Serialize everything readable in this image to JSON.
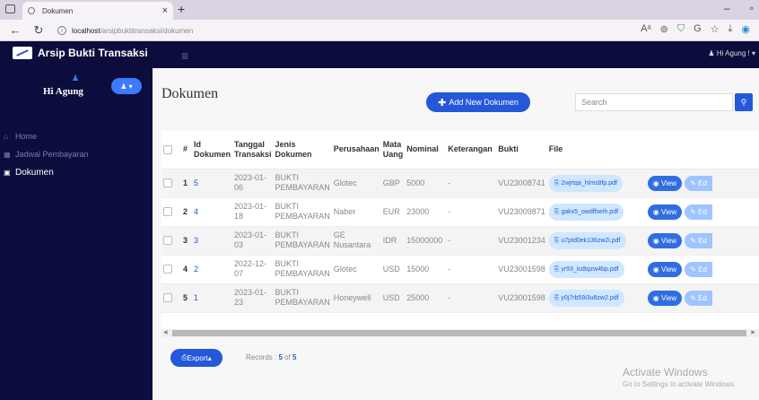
{
  "browser": {
    "tab_title": "Dokumen",
    "url_host": "localhost",
    "url_path": "/arsipbuktitransaksi/dokumen"
  },
  "app": {
    "brand": "Arsip Bukti Transaksi",
    "user_greeting": "Hi Agung !"
  },
  "sidebar": {
    "profile_name": "Hi Agung",
    "items": [
      {
        "label": "Home",
        "icon": "home-icon"
      },
      {
        "label": "Jadwal Pembayaran",
        "icon": "calendar-icon"
      },
      {
        "label": "Dokumen",
        "icon": "document-icon"
      }
    ],
    "active_index": 2
  },
  "main": {
    "title": "Dokumen",
    "add_button": "Add New Dokumen",
    "search_placeholder": "Search"
  },
  "table": {
    "headers": {
      "num": "#",
      "id": "Id Dokumen",
      "tanggal": "Tanggal Transaksi",
      "jenis": "Jenis Dokumen",
      "perusahaan": "Perusahaan",
      "mata_uang": "Mata Uang",
      "nominal": "Nominal",
      "keterangan": "Keterangan",
      "bukti": "Bukti",
      "file": "File"
    },
    "rows": [
      {
        "num": "1",
        "id": "5",
        "tanggal": "2023-01-06",
        "jenis": "BUKTI PEMBAYARAN",
        "perusahaan": "Glotec",
        "mata_uang": "GBP",
        "nominal": "5000",
        "keterangan": "-",
        "bukti": "VU23008741",
        "file": "2wjrtqa_hlms8fp.pdf"
      },
      {
        "num": "2",
        "id": "4",
        "tanggal": "2023-01-18",
        "jenis": "BUKTI PEMBAYARAN",
        "perusahaan": "Naber",
        "mata_uang": "EUR",
        "nominal": "23000",
        "keterangan": "-",
        "bukti": "VU23009871",
        "file": "gakx5_owdffseih.pdf"
      },
      {
        "num": "3",
        "id": "3",
        "tanggal": "2023-01-03",
        "jenis": "BUKTI PEMBAYARAN",
        "perusahaan": "GE Nusantara",
        "mata_uang": "IDR",
        "nominal": "15000000",
        "keterangan": "-",
        "bukti": "VU23001234",
        "file": "u7ptd0ek136zw2i.pdf"
      },
      {
        "num": "4",
        "id": "2",
        "tanggal": "2022-12-07",
        "jenis": "BUKTI PEMBAYARAN",
        "perusahaan": "Glotec",
        "mata_uang": "USD",
        "nominal": "15000",
        "keterangan": "-",
        "bukti": "VU23001598",
        "file": "yr93_icdtqzw4bp.pdf"
      },
      {
        "num": "5",
        "id": "1",
        "tanggal": "2023-01-23",
        "jenis": "BUKTI PEMBAYARAN",
        "perusahaan": "Honeywell",
        "mata_uang": "USD",
        "nominal": "25000",
        "keterangan": "-",
        "bukti": "VU23001598",
        "file": "y0j7rb59i3u8zw2.pdf"
      }
    ],
    "view_label": "View",
    "edit_label": "Ed"
  },
  "footer": {
    "export_label": "Export",
    "records_prefix": "Records : ",
    "records_count": "5",
    "records_of": " of ",
    "records_total": "5"
  },
  "watermark": {
    "title": "Activate Windows",
    "subtitle": "Go to Settings to activate Windows."
  }
}
